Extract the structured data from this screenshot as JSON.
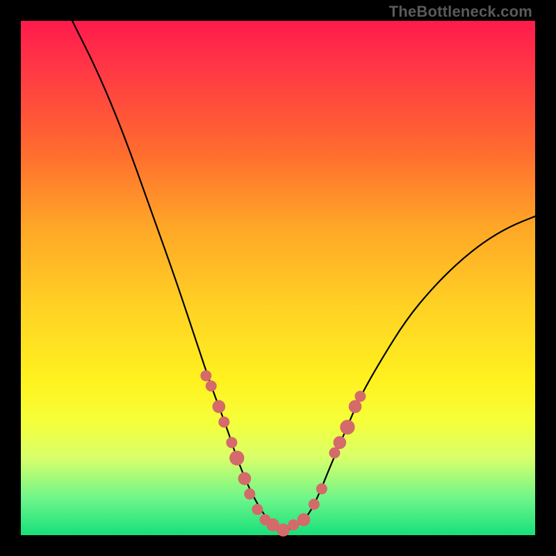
{
  "attribution": "TheBottleneck.com",
  "colors": {
    "frame": "#000000",
    "gradient_top": "#ff1a4d",
    "gradient_bottom": "#17e07a",
    "curve": "#000000",
    "marker": "#d46a6a"
  },
  "chart_data": {
    "type": "line",
    "title": "",
    "xlabel": "",
    "ylabel": "",
    "xlim": [
      0,
      100
    ],
    "ylim": [
      0,
      100
    ],
    "series": [
      {
        "name": "curve",
        "x": [
          10,
          15,
          20,
          25,
          30,
          34,
          37,
          40,
          42,
          44,
          46,
          48,
          50,
          52,
          54,
          56,
          58,
          60,
          63,
          66,
          70,
          75,
          80,
          85,
          90,
          95,
          100
        ],
        "values": [
          100,
          90,
          78,
          64,
          50,
          38,
          29,
          21,
          15,
          10,
          6,
          3,
          1,
          1,
          2,
          4,
          8,
          13,
          20,
          27,
          34,
          42,
          48,
          53,
          57,
          60,
          62
        ]
      }
    ],
    "markers": [
      {
        "x": 36,
        "y": 31,
        "r": 1.2
      },
      {
        "x": 37,
        "y": 29,
        "r": 1.2
      },
      {
        "x": 38.5,
        "y": 25,
        "r": 1.4
      },
      {
        "x": 39.5,
        "y": 22,
        "r": 1.2
      },
      {
        "x": 41,
        "y": 18,
        "r": 1.2
      },
      {
        "x": 42,
        "y": 15,
        "r": 1.6
      },
      {
        "x": 43.5,
        "y": 11,
        "r": 1.4
      },
      {
        "x": 44.5,
        "y": 8,
        "r": 1.2
      },
      {
        "x": 46,
        "y": 5,
        "r": 1.2
      },
      {
        "x": 47.5,
        "y": 3,
        "r": 1.2
      },
      {
        "x": 49,
        "y": 2,
        "r": 1.4
      },
      {
        "x": 51,
        "y": 1,
        "r": 1.4
      },
      {
        "x": 53,
        "y": 2,
        "r": 1.2
      },
      {
        "x": 55,
        "y": 3,
        "r": 1.4
      },
      {
        "x": 57,
        "y": 6,
        "r": 1.2
      },
      {
        "x": 58.5,
        "y": 9,
        "r": 1.2
      },
      {
        "x": 61,
        "y": 16,
        "r": 1.2
      },
      {
        "x": 62,
        "y": 18,
        "r": 1.4
      },
      {
        "x": 63.5,
        "y": 21,
        "r": 1.6
      },
      {
        "x": 65,
        "y": 25,
        "r": 1.4
      },
      {
        "x": 66,
        "y": 27,
        "r": 1.2
      }
    ]
  }
}
